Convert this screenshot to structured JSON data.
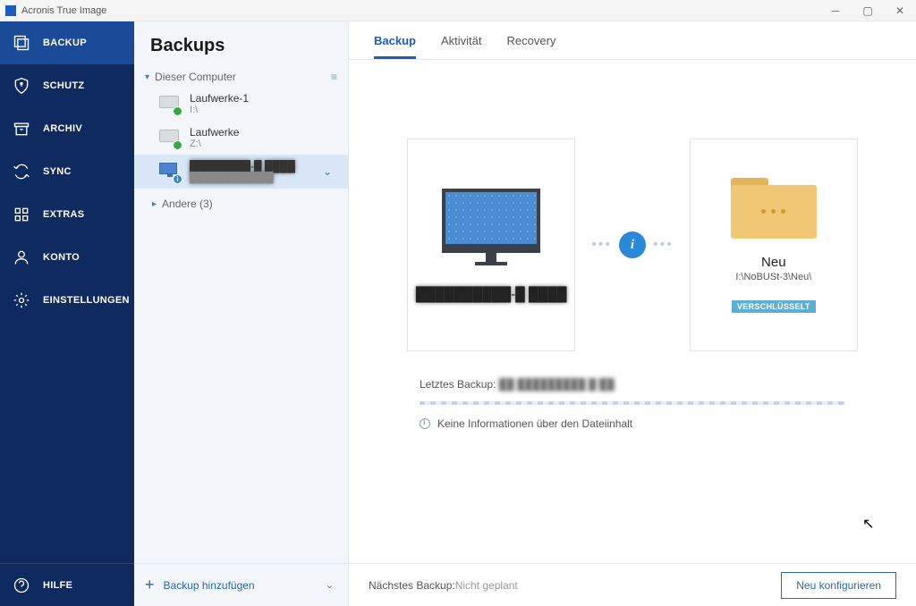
{
  "title": "Acronis True Image",
  "sidebar": {
    "items": [
      {
        "label": "BACKUP"
      },
      {
        "label": "SCHUTZ"
      },
      {
        "label": "ARCHIV"
      },
      {
        "label": "SYNC"
      },
      {
        "label": "EXTRAS"
      },
      {
        "label": "KONTO"
      },
      {
        "label": "EINSTELLUNGEN"
      }
    ],
    "help": "HILFE"
  },
  "backups": {
    "heading": "Backups",
    "group1": "Dieser Computer",
    "items": [
      {
        "name": "Laufwerke-1",
        "path": "I:\\"
      },
      {
        "name": "Laufwerke",
        "path": "Z:\\"
      }
    ],
    "selected": {
      "name": "████████-█ ████",
      "path": "████████████"
    },
    "group2": "Andere (3)",
    "add": "Backup hinzufügen"
  },
  "tabs": [
    "Backup",
    "Aktivität",
    "Recovery"
  ],
  "source": {
    "name": "██████████-█ ████"
  },
  "dest": {
    "name": "Neu",
    "path": "I:\\NoBUSt-3\\Neu\\",
    "encrypted": "VERSCHLÜSSELT"
  },
  "status": {
    "label": "Letztes Backup:",
    "value": "██ █████████ █:██",
    "info": "Keine Informationen über den Dateiinhalt"
  },
  "footer": {
    "next_label": "Nächstes Backup: ",
    "next_value": "Nicht geplant",
    "configure": "Neu konfigurieren"
  }
}
